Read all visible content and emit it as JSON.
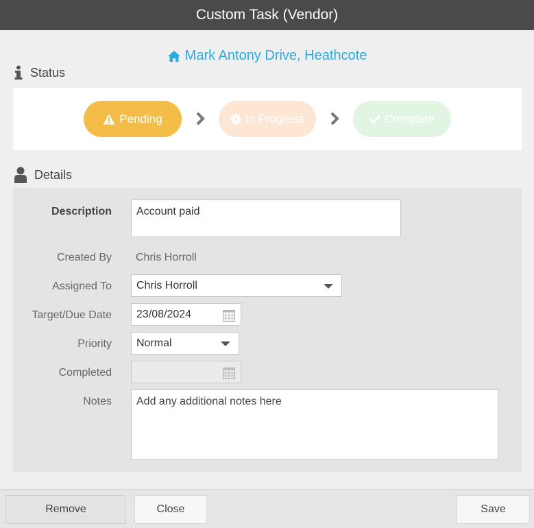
{
  "window": {
    "title": "Custom Task (Vendor)"
  },
  "address": {
    "text": "Mark Antony Drive, Heathcote",
    "icon": "home-icon",
    "color": "#29abe2"
  },
  "status_section": {
    "heading": "Status",
    "steps": [
      {
        "label": "Pending",
        "icon": "warning-icon",
        "state": "active",
        "color": "#f3bd47"
      },
      {
        "label": "In Progress",
        "icon": "gear-icon",
        "state": "inactive",
        "color": "#fde6d4"
      },
      {
        "label": "Complete",
        "icon": "check-icon",
        "state": "inactive",
        "color": "#e2f5e3"
      }
    ]
  },
  "details_section": {
    "heading": "Details",
    "description": {
      "label": "Description",
      "value": "Account paid"
    },
    "created_by": {
      "label": "Created By",
      "value": "Chris Horroll"
    },
    "assigned_to": {
      "label": "Assigned To",
      "value": "Chris Horroll"
    },
    "due_date": {
      "label": "Target/Due Date",
      "value": "23/08/2024"
    },
    "priority": {
      "label": "Priority",
      "value": "Normal"
    },
    "completed": {
      "label": "Completed",
      "value": ""
    },
    "notes": {
      "label": "Notes",
      "placeholder": "Add any additional notes here"
    }
  },
  "buttons": {
    "remove": "Remove",
    "close": "Close",
    "save": "Save"
  }
}
